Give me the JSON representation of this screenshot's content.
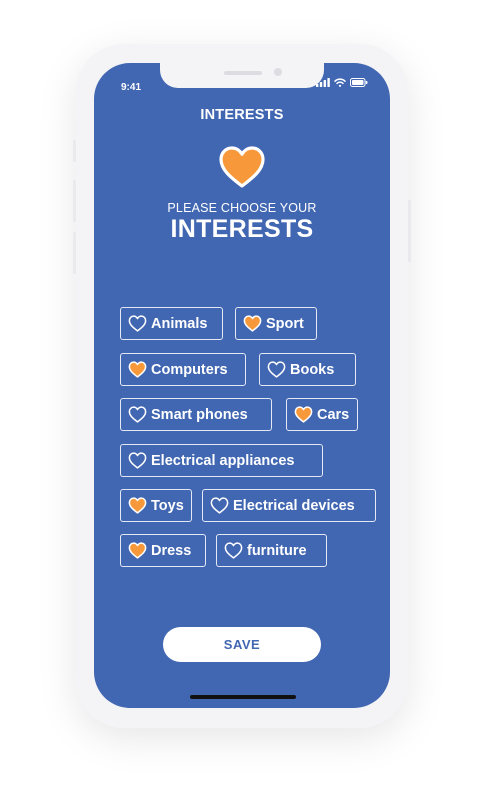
{
  "status_bar": {
    "time": "9:41"
  },
  "header": {
    "title": "INTERESTS"
  },
  "hero": {
    "subtitle": "PLEASE CHOOSE YOUR",
    "title": "INTERESTS"
  },
  "interests": [
    {
      "label": "Animals",
      "selected": false
    },
    {
      "label": "Sport",
      "selected": true
    },
    {
      "label": "Computers",
      "selected": true
    },
    {
      "label": "Books",
      "selected": false
    },
    {
      "label": "Smart phones",
      "selected": false
    },
    {
      "label": "Cars",
      "selected": true
    },
    {
      "label": "Electrical appliances",
      "selected": false
    },
    {
      "label": "Toys",
      "selected": true
    },
    {
      "label": "Electrical devices",
      "selected": false
    },
    {
      "label": "Dress",
      "selected": true
    },
    {
      "label": "furniture",
      "selected": false
    }
  ],
  "save_button": {
    "label": "SAVE"
  },
  "colors": {
    "background": "#4267b2",
    "accent": "#f7993a",
    "text": "#ffffff"
  },
  "icons": {
    "hero": "heart-icon",
    "chip_selected": "heart-filled-icon",
    "chip_unselected": "heart-outline-icon"
  }
}
